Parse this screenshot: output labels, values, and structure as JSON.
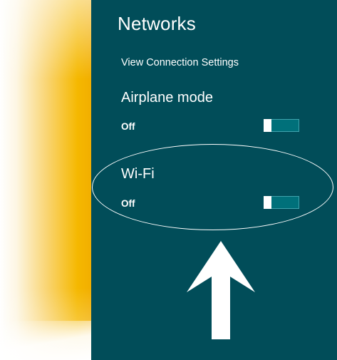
{
  "panel": {
    "title": "Networks",
    "view_settings_label": "View Connection Settings"
  },
  "airplane_mode": {
    "label": "Airplane mode",
    "state": "Off"
  },
  "wifi": {
    "label": "Wi-Fi",
    "state": "Off"
  },
  "colors": {
    "panel_background": "#014d59",
    "toggle_track": "#00707a",
    "toggle_thumb": "#ffffff",
    "desktop_accent": "#f5b800"
  },
  "icons": {
    "pointer": "up-arrow-icon"
  }
}
